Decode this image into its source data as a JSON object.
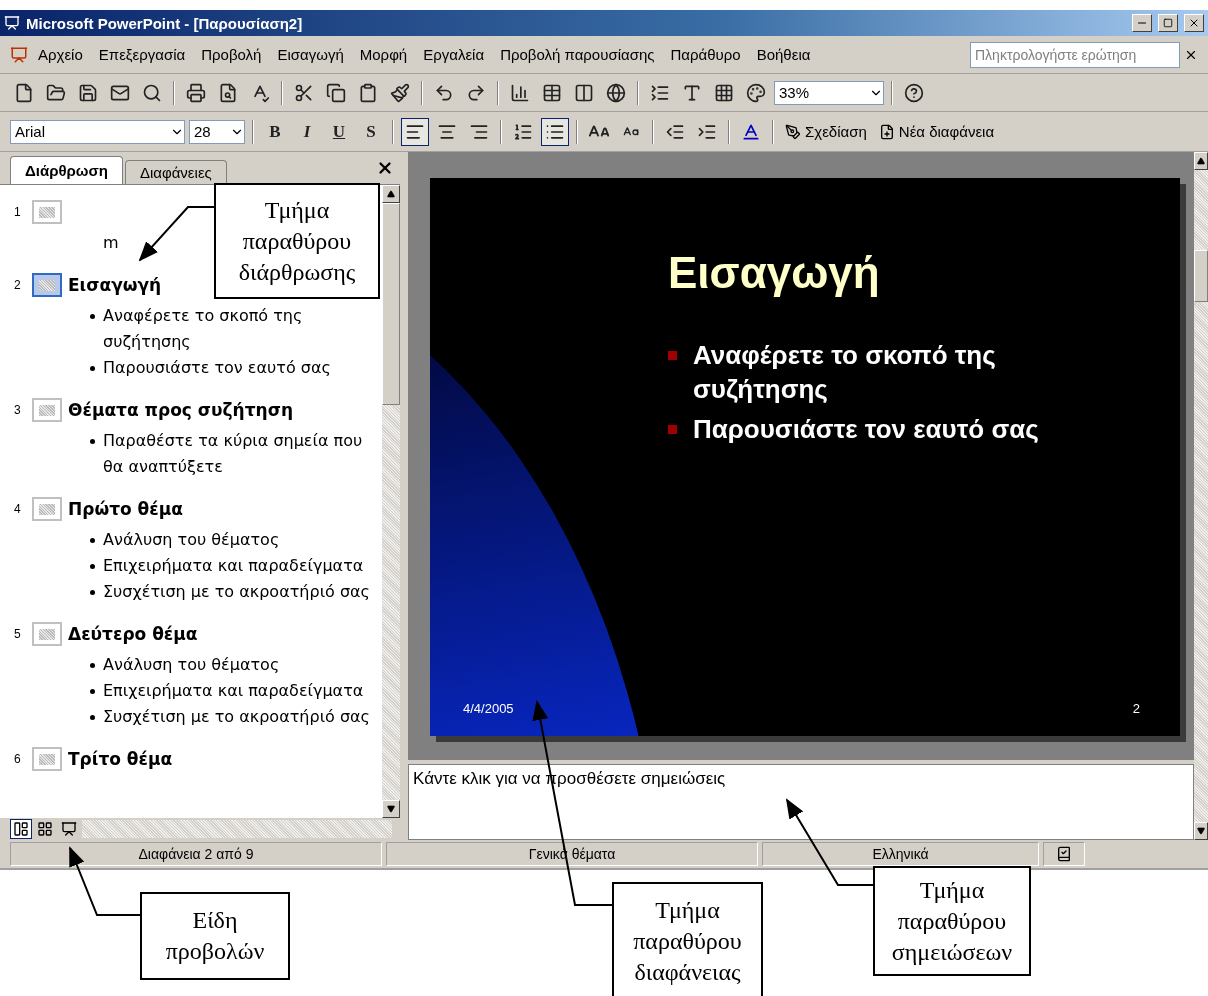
{
  "window": {
    "title": "Microsoft PowerPoint - [Παρουσίαση2]"
  },
  "menu": {
    "items": [
      "Αρχείο",
      "Επεξεργασία",
      "Προβολή",
      "Εισαγωγή",
      "Μορφή",
      "Εργαλεία",
      "Προβολή παρουσίασης",
      "Παράθυρο",
      "Βοήθεια"
    ],
    "question_box": {
      "placeholder": "Πληκτρολογήστε ερώτηση"
    }
  },
  "standard_toolbar": {
    "zoom": "33%"
  },
  "formatting_toolbar": {
    "font": "Arial",
    "size": "28",
    "style_buttons": [
      "B",
      "I",
      "U",
      "S"
    ],
    "alignment_buttons": [
      {
        "selected": true
      },
      {
        "selected": false
      },
      {
        "selected": false
      }
    ],
    "list_buttons": [
      {
        "selected": false
      },
      {
        "selected": true
      }
    ],
    "design": "Σχεδίαση",
    "new_slide": "Νέα διαφάνεια"
  },
  "tabs": [
    {
      "label": "Διάρθρωση",
      "selected": true
    },
    {
      "label": "Διαφάνειες",
      "selected": false
    }
  ],
  "outline": [
    {
      "number": "1",
      "selected": false,
      "lines": [
        {
          "kind": "plain",
          "text": "m"
        }
      ]
    },
    {
      "number": "2",
      "title": "Εισαγωγή",
      "selected": true,
      "lines": [
        {
          "kind": "bullet",
          "text": "Αναφέρετε το σκοπό της συζήτησης"
        },
        {
          "kind": "bullet",
          "text": "Παρουσιάστε τον εαυτό σας"
        }
      ]
    },
    {
      "number": "3",
      "title": "Θέματα προς συζήτηση",
      "selected": false,
      "lines": [
        {
          "kind": "bullet",
          "text": "Παραθέστε τα κύρια σημεία που θα αναπτύξετε"
        }
      ]
    },
    {
      "number": "4",
      "title": "Πρώτο θέμα",
      "selected": false,
      "lines": [
        {
          "kind": "bullet",
          "text": "Ανάλυση του θέματος"
        },
        {
          "kind": "bullet",
          "text": "Επιχειρήματα και παραδείγματα"
        },
        {
          "kind": "bullet",
          "text": "Συσχέτιση με το ακροατήριό σας"
        }
      ]
    },
    {
      "number": "5",
      "title": "Δεύτερο θέμα",
      "selected": false,
      "lines": [
        {
          "kind": "bullet",
          "text": "Ανάλυση του θέματος"
        },
        {
          "kind": "bullet",
          "text": "Επιχειρήματα και παραδείγματα"
        },
        {
          "kind": "bullet",
          "text": "Συσχέτιση με το ακροατήριό σας"
        }
      ]
    },
    {
      "number": "6",
      "title": "Τρίτο θέμα",
      "selected": false
    }
  ],
  "view_buttons": [
    {
      "selected": true
    },
    {
      "selected": false
    },
    {
      "selected": false
    }
  ],
  "slide": {
    "title": "Εισαγωγή",
    "bullets": [
      "Αναφέρετε το σκοπό της συζήτησης",
      "Παρουσιάστε τον εαυτό σας"
    ],
    "date": "4/4/2005",
    "number": "2"
  },
  "notes": {
    "placeholder": "Κάντε κλικ για να προσθέσετε σημειώσεις"
  },
  "status_bar": [
    "Διαφάνεια 2 από 9",
    "Γενικά θέματα",
    "Ελληνικά"
  ],
  "callouts": [
    "Τμήμα παραθύρου διάρθρωσης",
    "Είδη προβολών",
    "Τμήμα παραθύρου διαφάνειας",
    "Τμήμα παραθύρου σημειώσεων"
  ]
}
